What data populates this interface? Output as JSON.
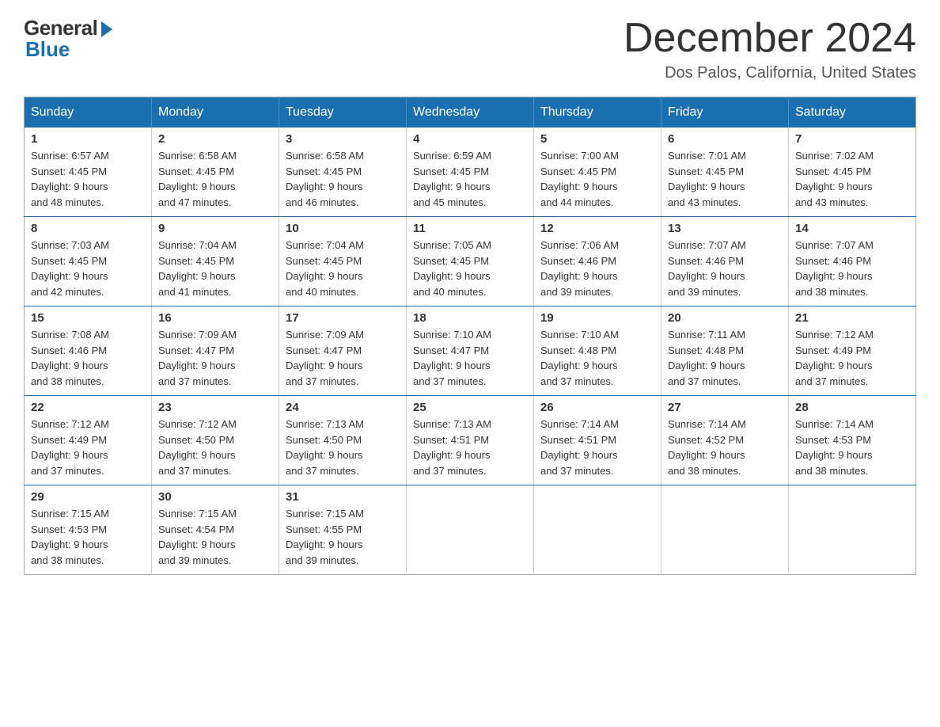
{
  "logo": {
    "general": "General",
    "blue": "Blue"
  },
  "header": {
    "month": "December 2024",
    "location": "Dos Palos, California, United States"
  },
  "days_of_week": [
    "Sunday",
    "Monday",
    "Tuesday",
    "Wednesday",
    "Thursday",
    "Friday",
    "Saturday"
  ],
  "weeks": [
    [
      {
        "day": "1",
        "sunrise": "6:57 AM",
        "sunset": "4:45 PM",
        "daylight": "9 hours and 48 minutes."
      },
      {
        "day": "2",
        "sunrise": "6:58 AM",
        "sunset": "4:45 PM",
        "daylight": "9 hours and 47 minutes."
      },
      {
        "day": "3",
        "sunrise": "6:58 AM",
        "sunset": "4:45 PM",
        "daylight": "9 hours and 46 minutes."
      },
      {
        "day": "4",
        "sunrise": "6:59 AM",
        "sunset": "4:45 PM",
        "daylight": "9 hours and 45 minutes."
      },
      {
        "day": "5",
        "sunrise": "7:00 AM",
        "sunset": "4:45 PM",
        "daylight": "9 hours and 44 minutes."
      },
      {
        "day": "6",
        "sunrise": "7:01 AM",
        "sunset": "4:45 PM",
        "daylight": "9 hours and 43 minutes."
      },
      {
        "day": "7",
        "sunrise": "7:02 AM",
        "sunset": "4:45 PM",
        "daylight": "9 hours and 43 minutes."
      }
    ],
    [
      {
        "day": "8",
        "sunrise": "7:03 AM",
        "sunset": "4:45 PM",
        "daylight": "9 hours and 42 minutes."
      },
      {
        "day": "9",
        "sunrise": "7:04 AM",
        "sunset": "4:45 PM",
        "daylight": "9 hours and 41 minutes."
      },
      {
        "day": "10",
        "sunrise": "7:04 AM",
        "sunset": "4:45 PM",
        "daylight": "9 hours and 40 minutes."
      },
      {
        "day": "11",
        "sunrise": "7:05 AM",
        "sunset": "4:45 PM",
        "daylight": "9 hours and 40 minutes."
      },
      {
        "day": "12",
        "sunrise": "7:06 AM",
        "sunset": "4:46 PM",
        "daylight": "9 hours and 39 minutes."
      },
      {
        "day": "13",
        "sunrise": "7:07 AM",
        "sunset": "4:46 PM",
        "daylight": "9 hours and 39 minutes."
      },
      {
        "day": "14",
        "sunrise": "7:07 AM",
        "sunset": "4:46 PM",
        "daylight": "9 hours and 38 minutes."
      }
    ],
    [
      {
        "day": "15",
        "sunrise": "7:08 AM",
        "sunset": "4:46 PM",
        "daylight": "9 hours and 38 minutes."
      },
      {
        "day": "16",
        "sunrise": "7:09 AM",
        "sunset": "4:47 PM",
        "daylight": "9 hours and 37 minutes."
      },
      {
        "day": "17",
        "sunrise": "7:09 AM",
        "sunset": "4:47 PM",
        "daylight": "9 hours and 37 minutes."
      },
      {
        "day": "18",
        "sunrise": "7:10 AM",
        "sunset": "4:47 PM",
        "daylight": "9 hours and 37 minutes."
      },
      {
        "day": "19",
        "sunrise": "7:10 AM",
        "sunset": "4:48 PM",
        "daylight": "9 hours and 37 minutes."
      },
      {
        "day": "20",
        "sunrise": "7:11 AM",
        "sunset": "4:48 PM",
        "daylight": "9 hours and 37 minutes."
      },
      {
        "day": "21",
        "sunrise": "7:12 AM",
        "sunset": "4:49 PM",
        "daylight": "9 hours and 37 minutes."
      }
    ],
    [
      {
        "day": "22",
        "sunrise": "7:12 AM",
        "sunset": "4:49 PM",
        "daylight": "9 hours and 37 minutes."
      },
      {
        "day": "23",
        "sunrise": "7:12 AM",
        "sunset": "4:50 PM",
        "daylight": "9 hours and 37 minutes."
      },
      {
        "day": "24",
        "sunrise": "7:13 AM",
        "sunset": "4:50 PM",
        "daylight": "9 hours and 37 minutes."
      },
      {
        "day": "25",
        "sunrise": "7:13 AM",
        "sunset": "4:51 PM",
        "daylight": "9 hours and 37 minutes."
      },
      {
        "day": "26",
        "sunrise": "7:14 AM",
        "sunset": "4:51 PM",
        "daylight": "9 hours and 37 minutes."
      },
      {
        "day": "27",
        "sunrise": "7:14 AM",
        "sunset": "4:52 PM",
        "daylight": "9 hours and 38 minutes."
      },
      {
        "day": "28",
        "sunrise": "7:14 AM",
        "sunset": "4:53 PM",
        "daylight": "9 hours and 38 minutes."
      }
    ],
    [
      {
        "day": "29",
        "sunrise": "7:15 AM",
        "sunset": "4:53 PM",
        "daylight": "9 hours and 38 minutes."
      },
      {
        "day": "30",
        "sunrise": "7:15 AM",
        "sunset": "4:54 PM",
        "daylight": "9 hours and 39 minutes."
      },
      {
        "day": "31",
        "sunrise": "7:15 AM",
        "sunset": "4:55 PM",
        "daylight": "9 hours and 39 minutes."
      },
      null,
      null,
      null,
      null
    ]
  ],
  "labels": {
    "sunrise": "Sunrise:",
    "sunset": "Sunset:",
    "daylight": "Daylight:"
  }
}
